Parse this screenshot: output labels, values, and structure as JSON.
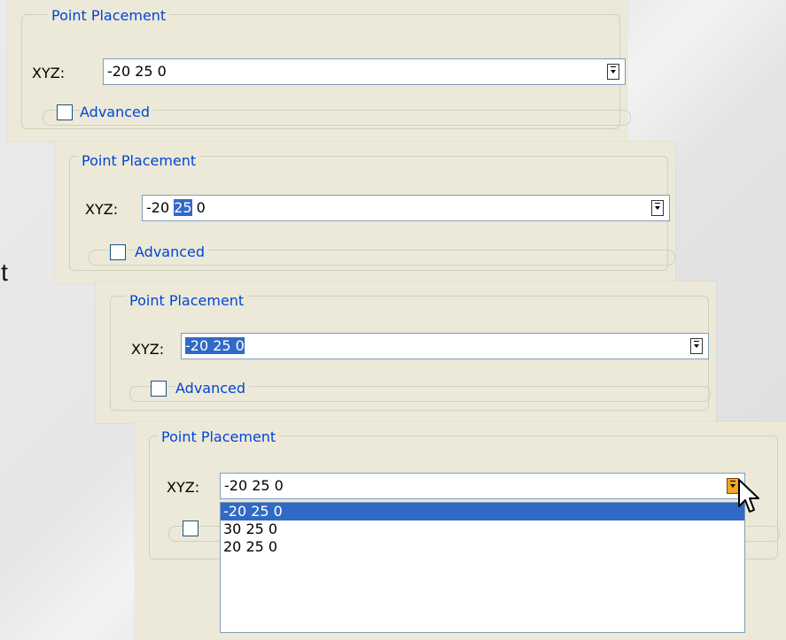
{
  "background": {
    "partial_text": "ght"
  },
  "group_title": "Point Placement",
  "xyz_label": "XYZ:",
  "advanced_label": "Advanced",
  "panels": [
    {
      "value": "-20 25 0"
    },
    {
      "value_before": "-20 ",
      "value_selected": "25",
      "value_after": " 0"
    },
    {
      "value_selected": "-20 25 0"
    },
    {
      "value": "-20 25 0"
    }
  ],
  "dropdown": {
    "options": [
      "-20 25 0",
      "30 25 0",
      "20 25 0"
    ],
    "selected_index": 0
  },
  "colors": {
    "panel_bg": "#ece9d8",
    "accent_blue": "#0046d5",
    "selection": "#316ac5",
    "button_hot": "#f5a623"
  }
}
